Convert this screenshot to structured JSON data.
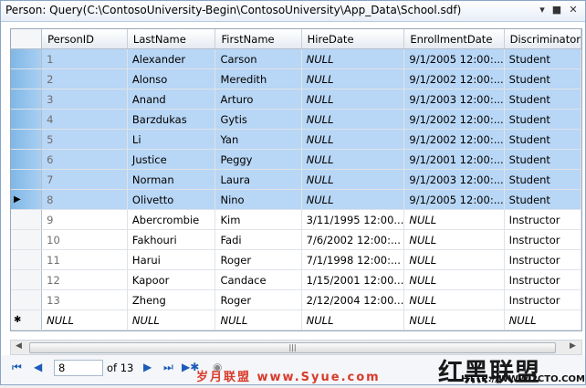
{
  "window": {
    "title": "Person: Query(C:\\ContosoUniversity-Begin\\ContosoUniversity\\App_Data\\School.sdf)",
    "buttons": {
      "dropdown": "▾",
      "maximize": "■",
      "close": "✕"
    }
  },
  "grid": {
    "columns": [
      "PersonID",
      "LastName",
      "FirstName",
      "HireDate",
      "EnrollmentDate",
      "Discriminator"
    ],
    "rows": [
      {
        "id": "1",
        "last": "Alexander",
        "first": "Carson",
        "hire": "NULL",
        "enroll": "9/1/2005 12:00:...",
        "disc": "Student",
        "selected": true
      },
      {
        "id": "2",
        "last": "Alonso",
        "first": "Meredith",
        "hire": "NULL",
        "enroll": "9/1/2002 12:00:...",
        "disc": "Student",
        "selected": true
      },
      {
        "id": "3",
        "last": "Anand",
        "first": "Arturo",
        "hire": "NULL",
        "enroll": "9/1/2003 12:00:...",
        "disc": "Student",
        "selected": true
      },
      {
        "id": "4",
        "last": "Barzdukas",
        "first": "Gytis",
        "hire": "NULL",
        "enroll": "9/1/2002 12:00:...",
        "disc": "Student",
        "selected": true
      },
      {
        "id": "5",
        "last": "Li",
        "first": "Yan",
        "hire": "NULL",
        "enroll": "9/1/2002 12:00:...",
        "disc": "Student",
        "selected": true
      },
      {
        "id": "6",
        "last": "Justice",
        "first": "Peggy",
        "hire": "NULL",
        "enroll": "9/1/2001 12:00:...",
        "disc": "Student",
        "selected": true
      },
      {
        "id": "7",
        "last": "Norman",
        "first": "Laura",
        "hire": "NULL",
        "enroll": "9/1/2003 12:00:...",
        "disc": "Student",
        "selected": true
      },
      {
        "id": "8",
        "last": "Olivetto",
        "first": "Nino",
        "hire": "NULL",
        "enroll": "9/1/2005 12:00:...",
        "disc": "Student",
        "selected": true,
        "current": true
      },
      {
        "id": "9",
        "last": "Abercrombie",
        "first": "Kim",
        "hire": "3/11/1995 12:00...",
        "enroll": "NULL",
        "disc": "Instructor"
      },
      {
        "id": "10",
        "last": "Fakhouri",
        "first": "Fadi",
        "hire": "7/6/2002 12:00:...",
        "enroll": "NULL",
        "disc": "Instructor"
      },
      {
        "id": "11",
        "last": "Harui",
        "first": "Roger",
        "hire": "7/1/1998 12:00:...",
        "enroll": "NULL",
        "disc": "Instructor"
      },
      {
        "id": "12",
        "last": "Kapoor",
        "first": "Candace",
        "hire": "1/15/2001 12:00...",
        "enroll": "NULL",
        "disc": "Instructor"
      },
      {
        "id": "13",
        "last": "Zheng",
        "first": "Roger",
        "hire": "2/12/2004 12:00...",
        "enroll": "NULL",
        "disc": "Instructor"
      },
      {
        "id": "NULL",
        "last": "NULL",
        "first": "NULL",
        "hire": "NULL",
        "enroll": "NULL",
        "disc": "NULL",
        "newrow": true
      }
    ],
    "current_marker": "▶",
    "new_marker": "✱"
  },
  "navigator": {
    "position": "8",
    "of_label": "of 13",
    "icons": [
      "first-icon",
      "previous-icon",
      "next-icon",
      "last-icon",
      "add-new-icon",
      "stop-icon"
    ]
  },
  "watermark": {
    "cn_logo": "红黑联盟",
    "cn_site": "岁月联盟 www.Syue.com",
    "url": "HTTP://WWW.2CTO.COM"
  },
  "colors": {
    "selection": "#b8d6f5",
    "nav_icon": "#1c5bb8"
  }
}
